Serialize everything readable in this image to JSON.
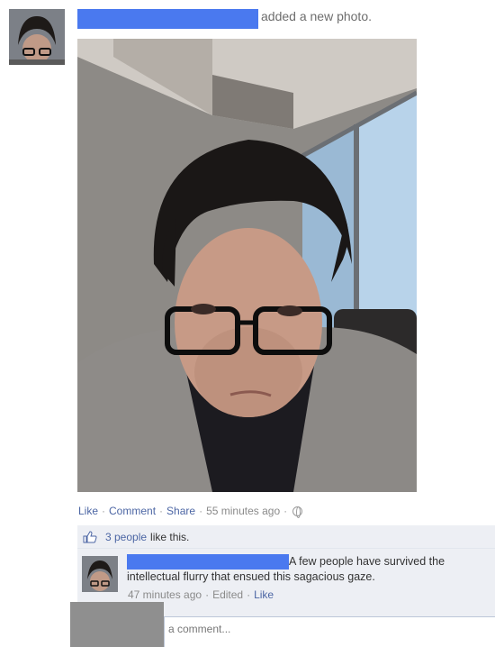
{
  "story": {
    "action_text": "added a new photo."
  },
  "actions": {
    "like": "Like",
    "comment": "Comment",
    "share": "Share",
    "timestamp": "55 minutes ago",
    "separator": "·"
  },
  "likes": {
    "count_text": "3 people",
    "suffix": "like this."
  },
  "comment": {
    "text_line1": "A few people have survived the",
    "text_line2": "intellectual flurry that ensued this sagacious gaze.",
    "timestamp": "47 minutes ago",
    "edited": "Edited",
    "like": "Like"
  },
  "composer": {
    "placeholder": "a comment..."
  },
  "colors": {
    "link": "#4c66a4",
    "redaction": "#4a79ef",
    "ufi_bg": "#edeff4"
  },
  "icons": [
    "globe-icon",
    "thumbs-up-icon"
  ]
}
